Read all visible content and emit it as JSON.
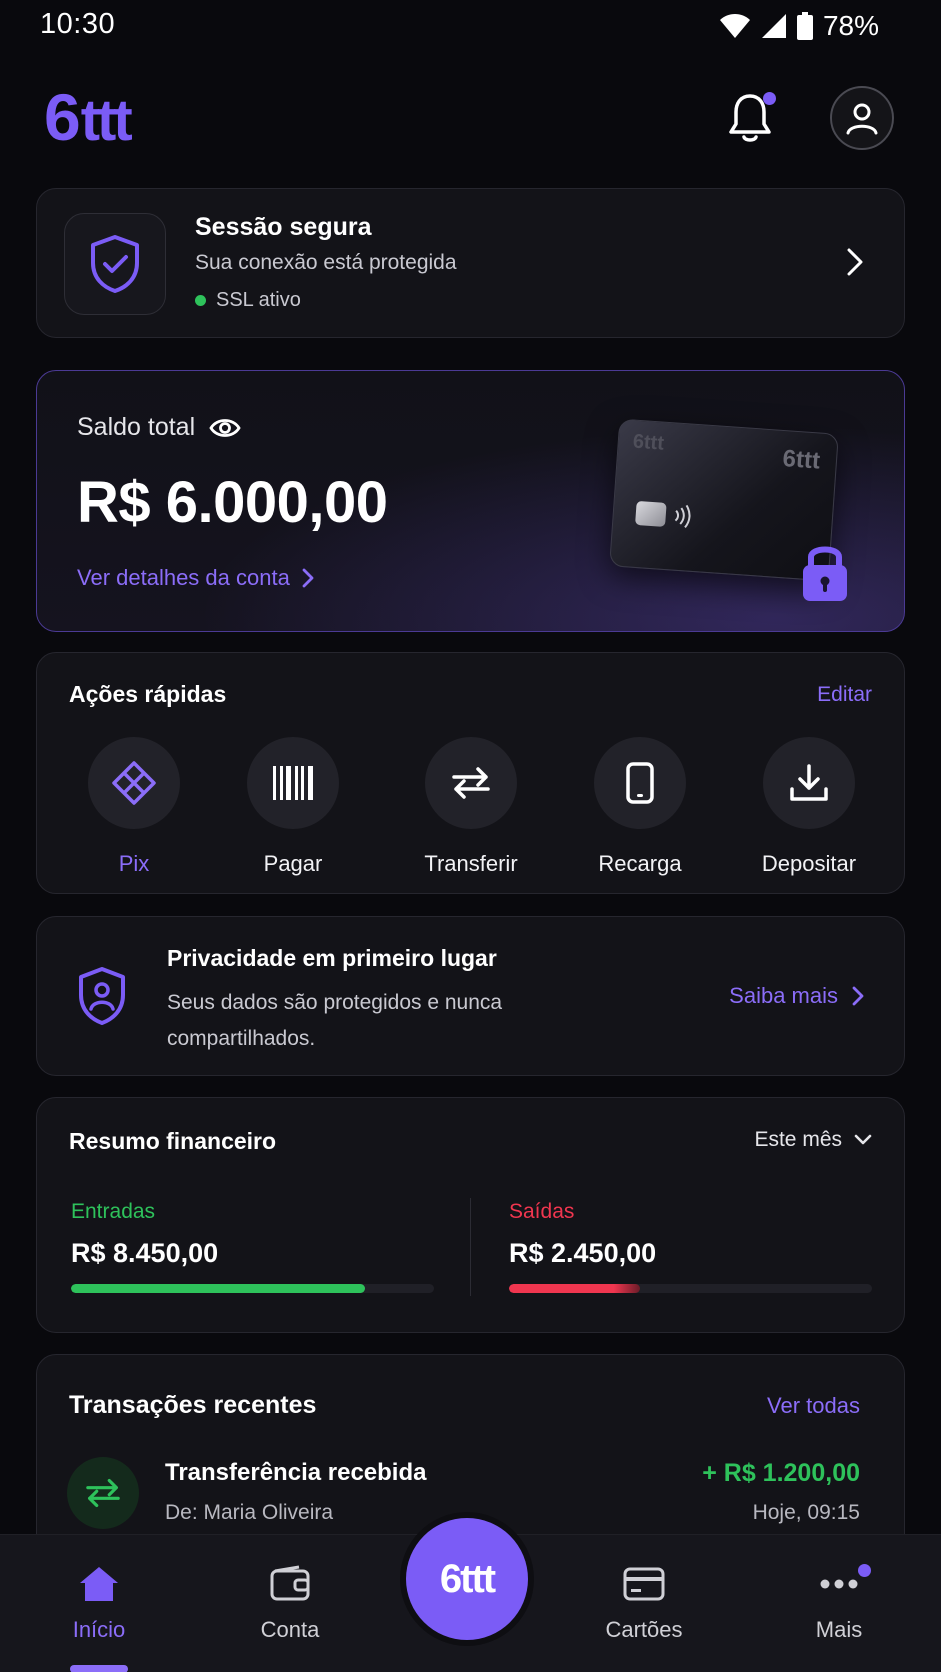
{
  "status_bar": {
    "time": "10:30",
    "battery": "78%"
  },
  "header": {
    "logo_six": "6",
    "logo_rest": "ttt"
  },
  "session": {
    "title": "Sessão segura",
    "subtitle": "Sua conexão está protegida",
    "status": "SSL ativo"
  },
  "balance": {
    "label": "Saldo total",
    "value": "R$ 6.000,00",
    "link": "Ver detalhes da conta",
    "card_logo": "6ttt"
  },
  "quick_actions": {
    "title": "Ações rápidas",
    "edit": "Editar",
    "items": [
      {
        "label": "Pix",
        "icon": "pix-icon"
      },
      {
        "label": "Pagar",
        "icon": "barcode-icon"
      },
      {
        "label": "Transferir",
        "icon": "transfer-icon"
      },
      {
        "label": "Recarga",
        "icon": "phone-icon"
      },
      {
        "label": "Depositar",
        "icon": "download-icon"
      }
    ]
  },
  "privacy": {
    "title": "Privacidade em primeiro lugar",
    "text": "Seus dados são protegidos e nunca compartilhados.",
    "link": "Saiba mais"
  },
  "summary": {
    "title": "Resumo financeiro",
    "period": "Este mês",
    "income": {
      "label": "Entradas",
      "value": "R$ 8.450,00",
      "progress": 0.81,
      "color": "#2ec25b"
    },
    "expense": {
      "label": "Saídas",
      "value": "R$ 2.450,00",
      "progress": 0.36,
      "color": "#f0364f"
    }
  },
  "transactions": {
    "title": "Transações recentes",
    "see_all": "Ver todas",
    "items": [
      {
        "name": "Transferência recebida",
        "from": "De: Maria Oliveira",
        "amount": "+ R$ 1.200,00",
        "time": "Hoje, 09:15"
      }
    ]
  },
  "nav": {
    "items": [
      {
        "label": "Início",
        "icon": "home-icon"
      },
      {
        "label": "Conta",
        "icon": "wallet-icon"
      },
      {
        "label": "Cartões",
        "icon": "card-icon"
      },
      {
        "label": "Mais",
        "icon": "more-icon"
      }
    ],
    "center_logo": "6ttt"
  },
  "colors": {
    "accent": "#7b5cf6",
    "success": "#2ec25b",
    "danger": "#f0364f",
    "background": "#09090d"
  }
}
